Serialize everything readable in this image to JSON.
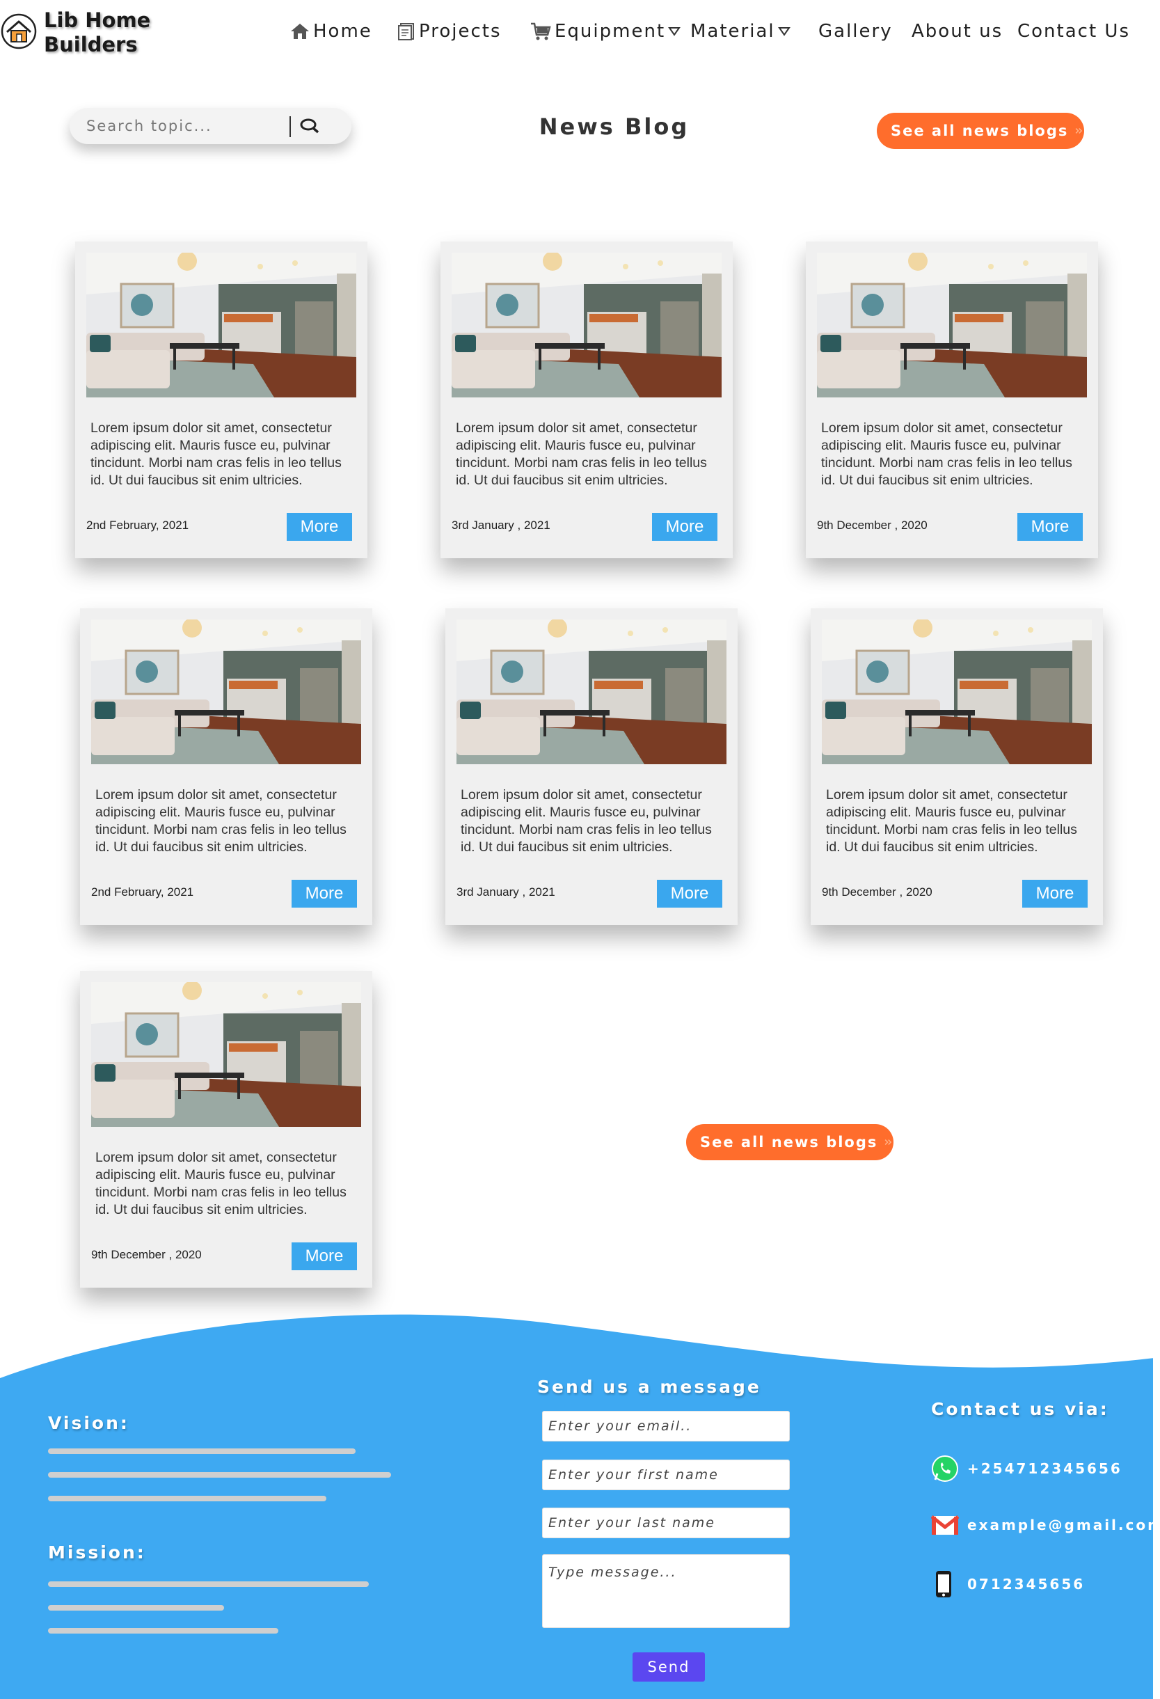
{
  "header": {
    "brand_line1": "Lib Home",
    "brand_line2": "Builders",
    "nav": [
      {
        "label": "Home",
        "icon": "home-icon"
      },
      {
        "label": "Projects",
        "icon": "projects-icon"
      },
      {
        "label": "Equipment",
        "icon": "cart-icon",
        "dropdown": true
      },
      {
        "label": "Material",
        "dropdown": true
      },
      {
        "label": "Gallery"
      },
      {
        "label": "About us"
      },
      {
        "label": "Contact Us"
      }
    ]
  },
  "search": {
    "placeholder": "Search topic..."
  },
  "page_title": "News Blog",
  "see_all_label": "See all news blogs",
  "cards": [
    {
      "text": "Lorem ipsum dolor sit amet, consectetur adipiscing elit. Mauris fusce eu, pulvinar tincidunt. Morbi nam cras felis in leo tellus id. Ut dui faucibus sit enim ultricies.",
      "date": "2nd February, 2021",
      "more": "More"
    },
    {
      "text": "Lorem ipsum dolor sit amet, consectetur adipiscing elit. Mauris fusce eu, pulvinar tincidunt. Morbi nam cras felis in leo tellus id. Ut dui faucibus sit enim ultricies.",
      "date": "3rd January , 2021",
      "more": "More"
    },
    {
      "text": "Lorem ipsum dolor sit amet, consectetur adipiscing elit. Mauris fusce eu, pulvinar tincidunt. Morbi nam cras felis in leo tellus id. Ut dui faucibus sit enim ultricies.",
      "date": "9th December , 2020",
      "more": "More"
    },
    {
      "text": "Lorem ipsum dolor sit amet, consectetur adipiscing elit. Mauris fusce eu, pulvinar tincidunt. Morbi nam cras felis in leo tellus id. Ut dui faucibus sit enim ultricies.",
      "date": "2nd February, 2021",
      "more": "More"
    },
    {
      "text": "Lorem ipsum dolor sit amet, consectetur adipiscing elit. Mauris fusce eu, pulvinar tincidunt. Morbi nam cras felis in leo tellus id. Ut dui faucibus sit enim ultricies.",
      "date": "3rd January , 2021",
      "more": "More"
    },
    {
      "text": "Lorem ipsum dolor sit amet, consectetur adipiscing elit. Mauris fusce eu, pulvinar tincidunt. Morbi nam cras felis in leo tellus id. Ut dui faucibus sit enim ultricies.",
      "date": "9th December , 2020",
      "more": "More"
    },
    {
      "text": "Lorem ipsum dolor sit amet, consectetur adipiscing elit. Mauris fusce eu, pulvinar tincidunt. Morbi nam cras felis in leo tellus id. Ut dui faucibus sit enim ultricies.",
      "date": "9th December , 2020",
      "more": "More"
    }
  ],
  "footer": {
    "vision": "Vision:",
    "mission": "Mission:",
    "form_title": "Send us a message",
    "email_placeholder": "Enter your email..",
    "first_name_placeholder": "Enter your first name",
    "last_name_placeholder": "Enter your last name",
    "message_placeholder": "Type message...",
    "send_label": "Send",
    "contact_title": "Contact us via:",
    "whatsapp": "+254712345656",
    "email": "example@gmail.com",
    "phone": "0712345656"
  },
  "colors": {
    "accent_orange": "#ff6d2c",
    "button_blue": "#3aa7ee",
    "footer_blue": "#3ea9f2",
    "send_purple": "#5b47f0"
  }
}
